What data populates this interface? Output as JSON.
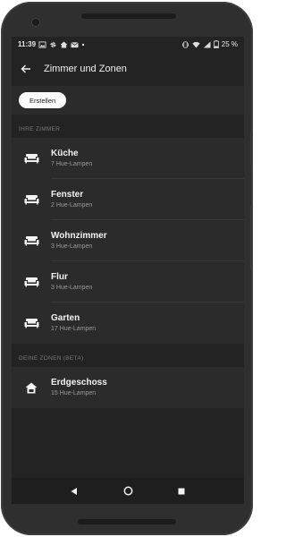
{
  "status": {
    "time": "11:39",
    "battery": "25 %"
  },
  "appbar": {
    "title": "Zimmer und Zonen"
  },
  "toolbar": {
    "create_label": "Erstellen"
  },
  "rooms": {
    "header": "IHRE ZIMMER",
    "items": [
      {
        "name": "Küche",
        "sub": "7 Hue-Lampen",
        "icon": "sofa-icon"
      },
      {
        "name": "Fenster",
        "sub": "2 Hue-Lampen",
        "icon": "sofa-icon"
      },
      {
        "name": "Wohnzimmer",
        "sub": "3 Hue-Lampen",
        "icon": "sofa-icon"
      },
      {
        "name": "Flur",
        "sub": "3 Hue-Lampen",
        "icon": "sofa-icon"
      },
      {
        "name": "Garten",
        "sub": "17 Hue-Lampen",
        "icon": "sofa-icon"
      }
    ]
  },
  "zones": {
    "header": "DEINE ZONEN (BETA)",
    "items": [
      {
        "name": "Erdgeschoss",
        "sub": "15 Hue-Lampen",
        "icon": "home-icon"
      }
    ]
  },
  "colors": {
    "background": "#232323",
    "panel": "#2b2b2b",
    "text": "#f4f4f4",
    "subtext": "#9a9a9a",
    "button": "#ffffff"
  }
}
